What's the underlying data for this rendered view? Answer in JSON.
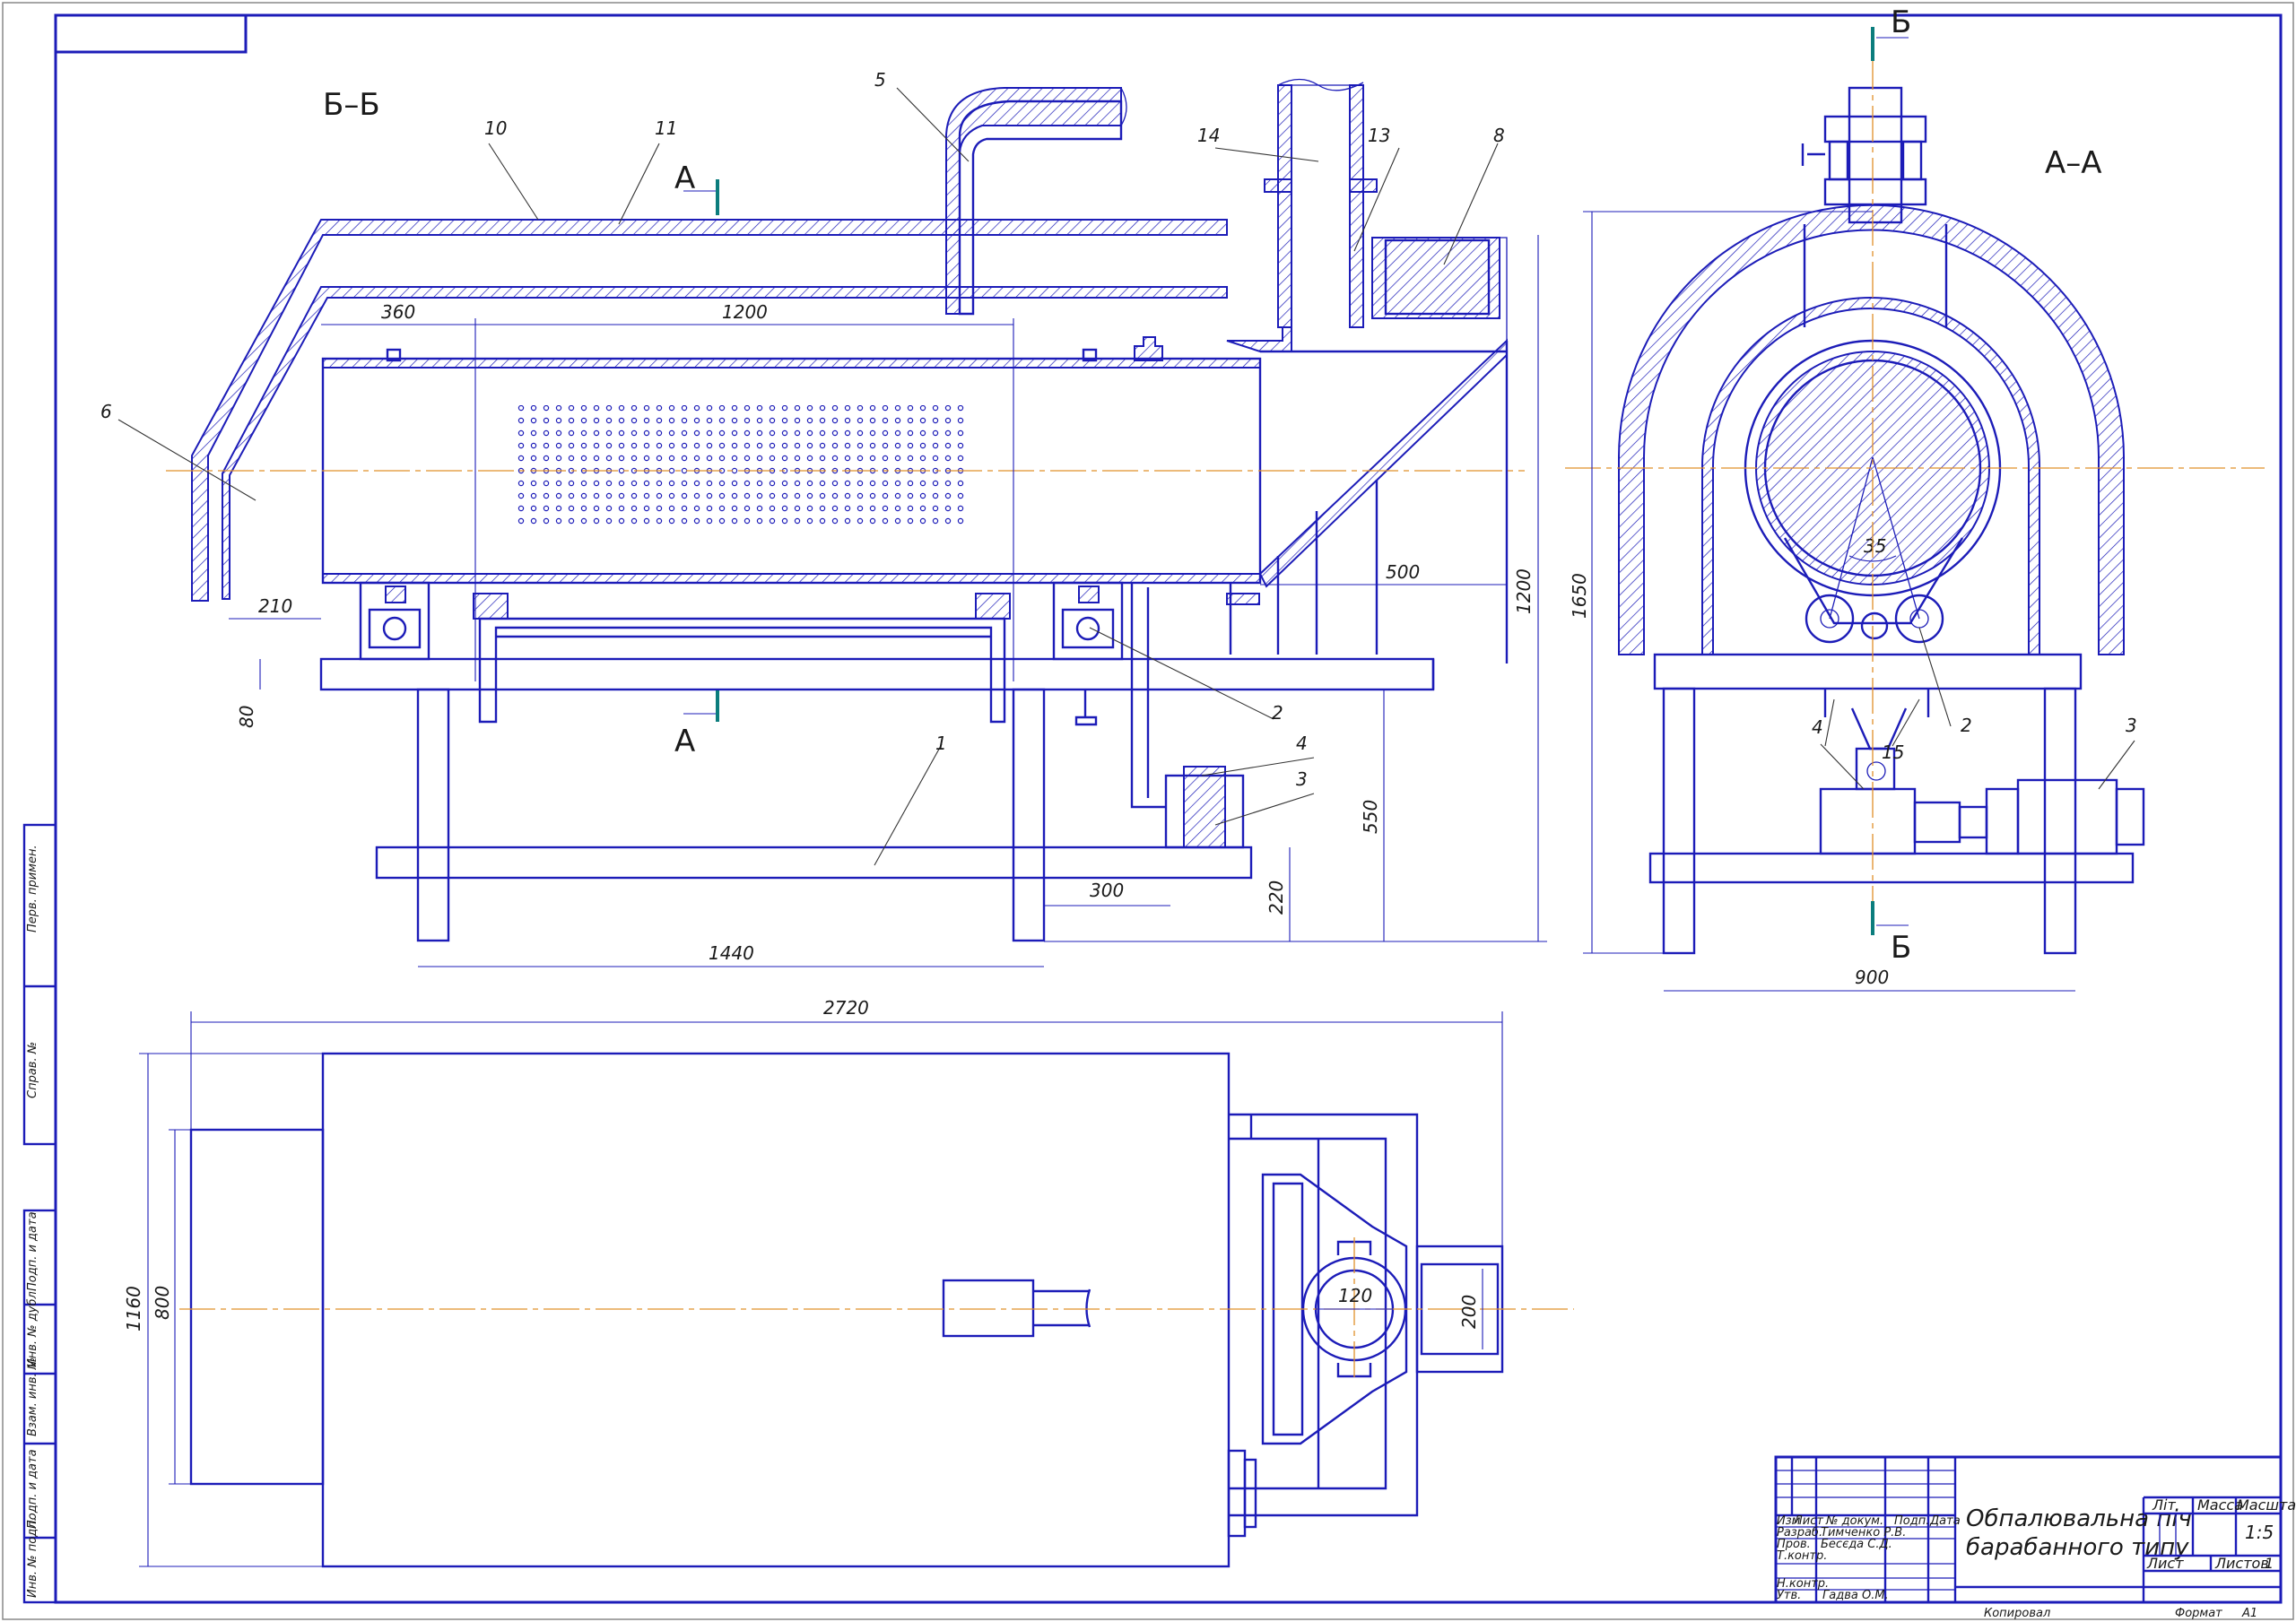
{
  "title_block": {
    "drawing_title_line1": "Обпалювальна піч",
    "drawing_title_line2": "барабанного типу",
    "col_lit": "Літ",
    "col_mass": "Масса",
    "col_scale": "Масштаб",
    "scale_value": "1:5",
    "sheet_label": "Лист",
    "sheets_label": "Листов",
    "sheets_value": "1",
    "row_headers": [
      "Изм",
      "Лист",
      "№ докум.",
      "Подп.",
      "Дата"
    ],
    "roles": [
      "Разраб.",
      "Пров.",
      "Т.контр.",
      "Н.контр.",
      "Утв."
    ],
    "names": [
      "Тимченко Р.В.",
      "Бесєда С.Д.",
      "",
      "",
      "Гадва О.М."
    ],
    "copied": "Копировал",
    "format_label": "Формат",
    "format_value": "А1"
  },
  "side_stamp": [
    "Перв. примен.",
    "Справ. №",
    "Подп. и дата",
    "Инв. № дубл.",
    "Взам. инв. №",
    "Подп. и дата",
    "Инв. № подл."
  ],
  "views": {
    "section_bb": "Б–Б",
    "section_aa": "А–А",
    "cut_a": "А",
    "cut_b": "Б"
  },
  "part_numbers": [
    "1",
    "2",
    "3",
    "4",
    "5",
    "6",
    "8",
    "10",
    "11",
    "13",
    "14",
    "15"
  ],
  "dimensions": {
    "d360": "360",
    "d1200_top": "1200",
    "d210": "210",
    "d80": "80",
    "d500": "500",
    "d1200_v": "1200",
    "d550": "550",
    "d220": "220",
    "d300": "300",
    "d1440": "1440",
    "d1650": "1650",
    "d35": "35",
    "d900": "900",
    "d2720": "2720",
    "d1160": "1160",
    "d800": "800",
    "d120": "120",
    "d200": "200"
  }
}
